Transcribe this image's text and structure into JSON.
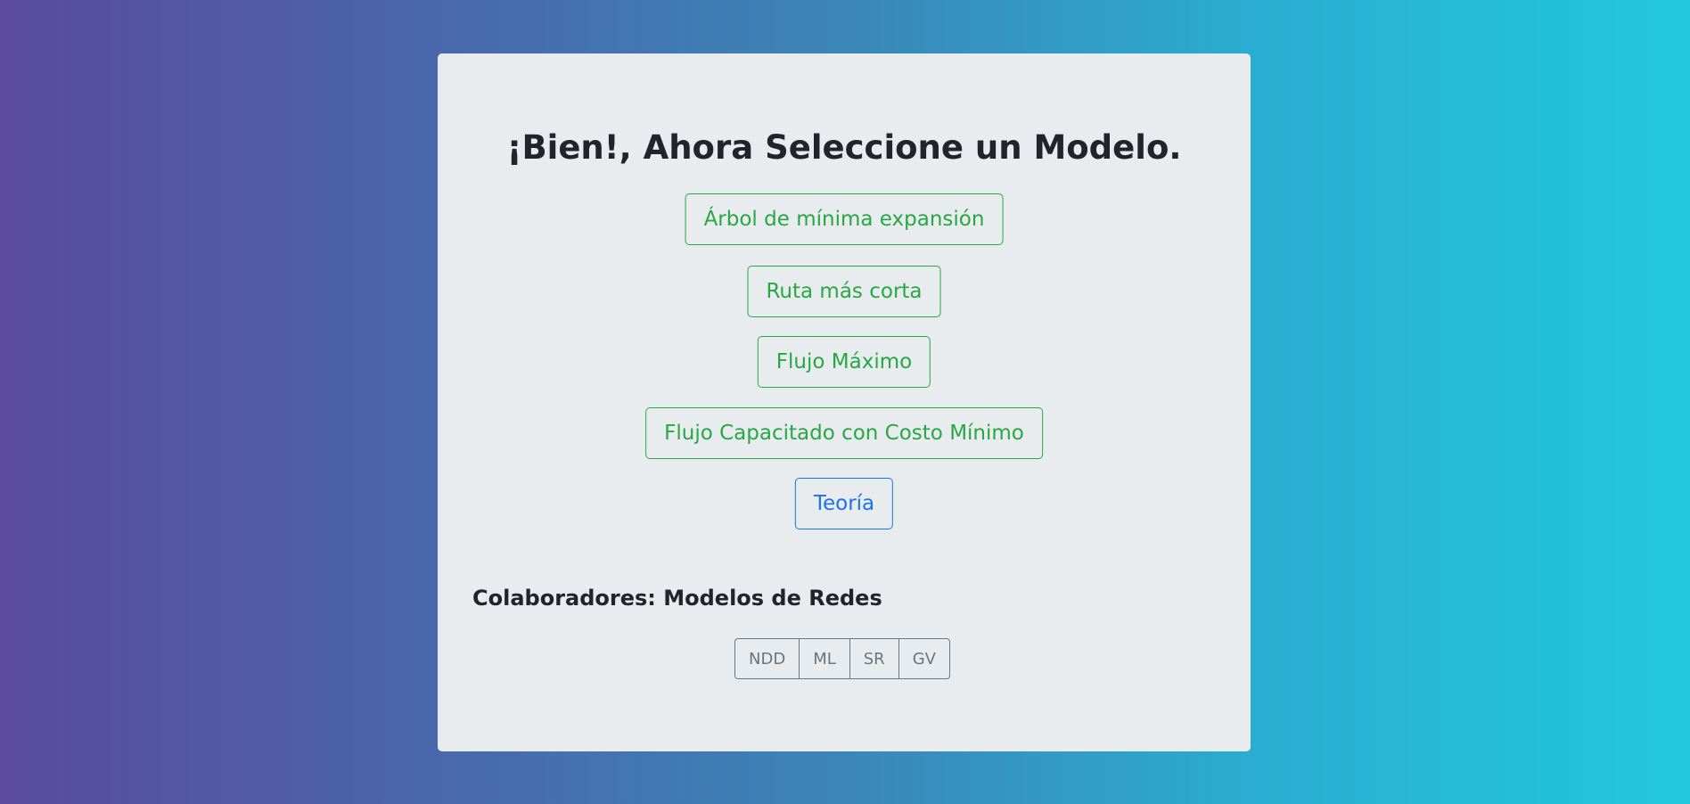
{
  "heading": "¡Bien!, Ahora Seleccione un Modelo.",
  "models": [
    {
      "label": "Árbol de mínima expansión"
    },
    {
      "label": "Ruta más corta"
    },
    {
      "label": "Flujo Máximo"
    },
    {
      "label": "Flujo Capacitado con Costo Mínimo"
    }
  ],
  "theory_label": "Teoría",
  "collaborators": {
    "title": "Colaboradores: Modelos de Redes",
    "buttons": [
      "NDD",
      "ML",
      "SR",
      "GV"
    ]
  },
  "colors": {
    "success": "#28a745",
    "primary": "#1a73e8",
    "secondary": "#6c757d",
    "card_bg": "#e9ecef",
    "gradient_start": "#5a4aa0",
    "gradient_end": "#22c8de"
  }
}
